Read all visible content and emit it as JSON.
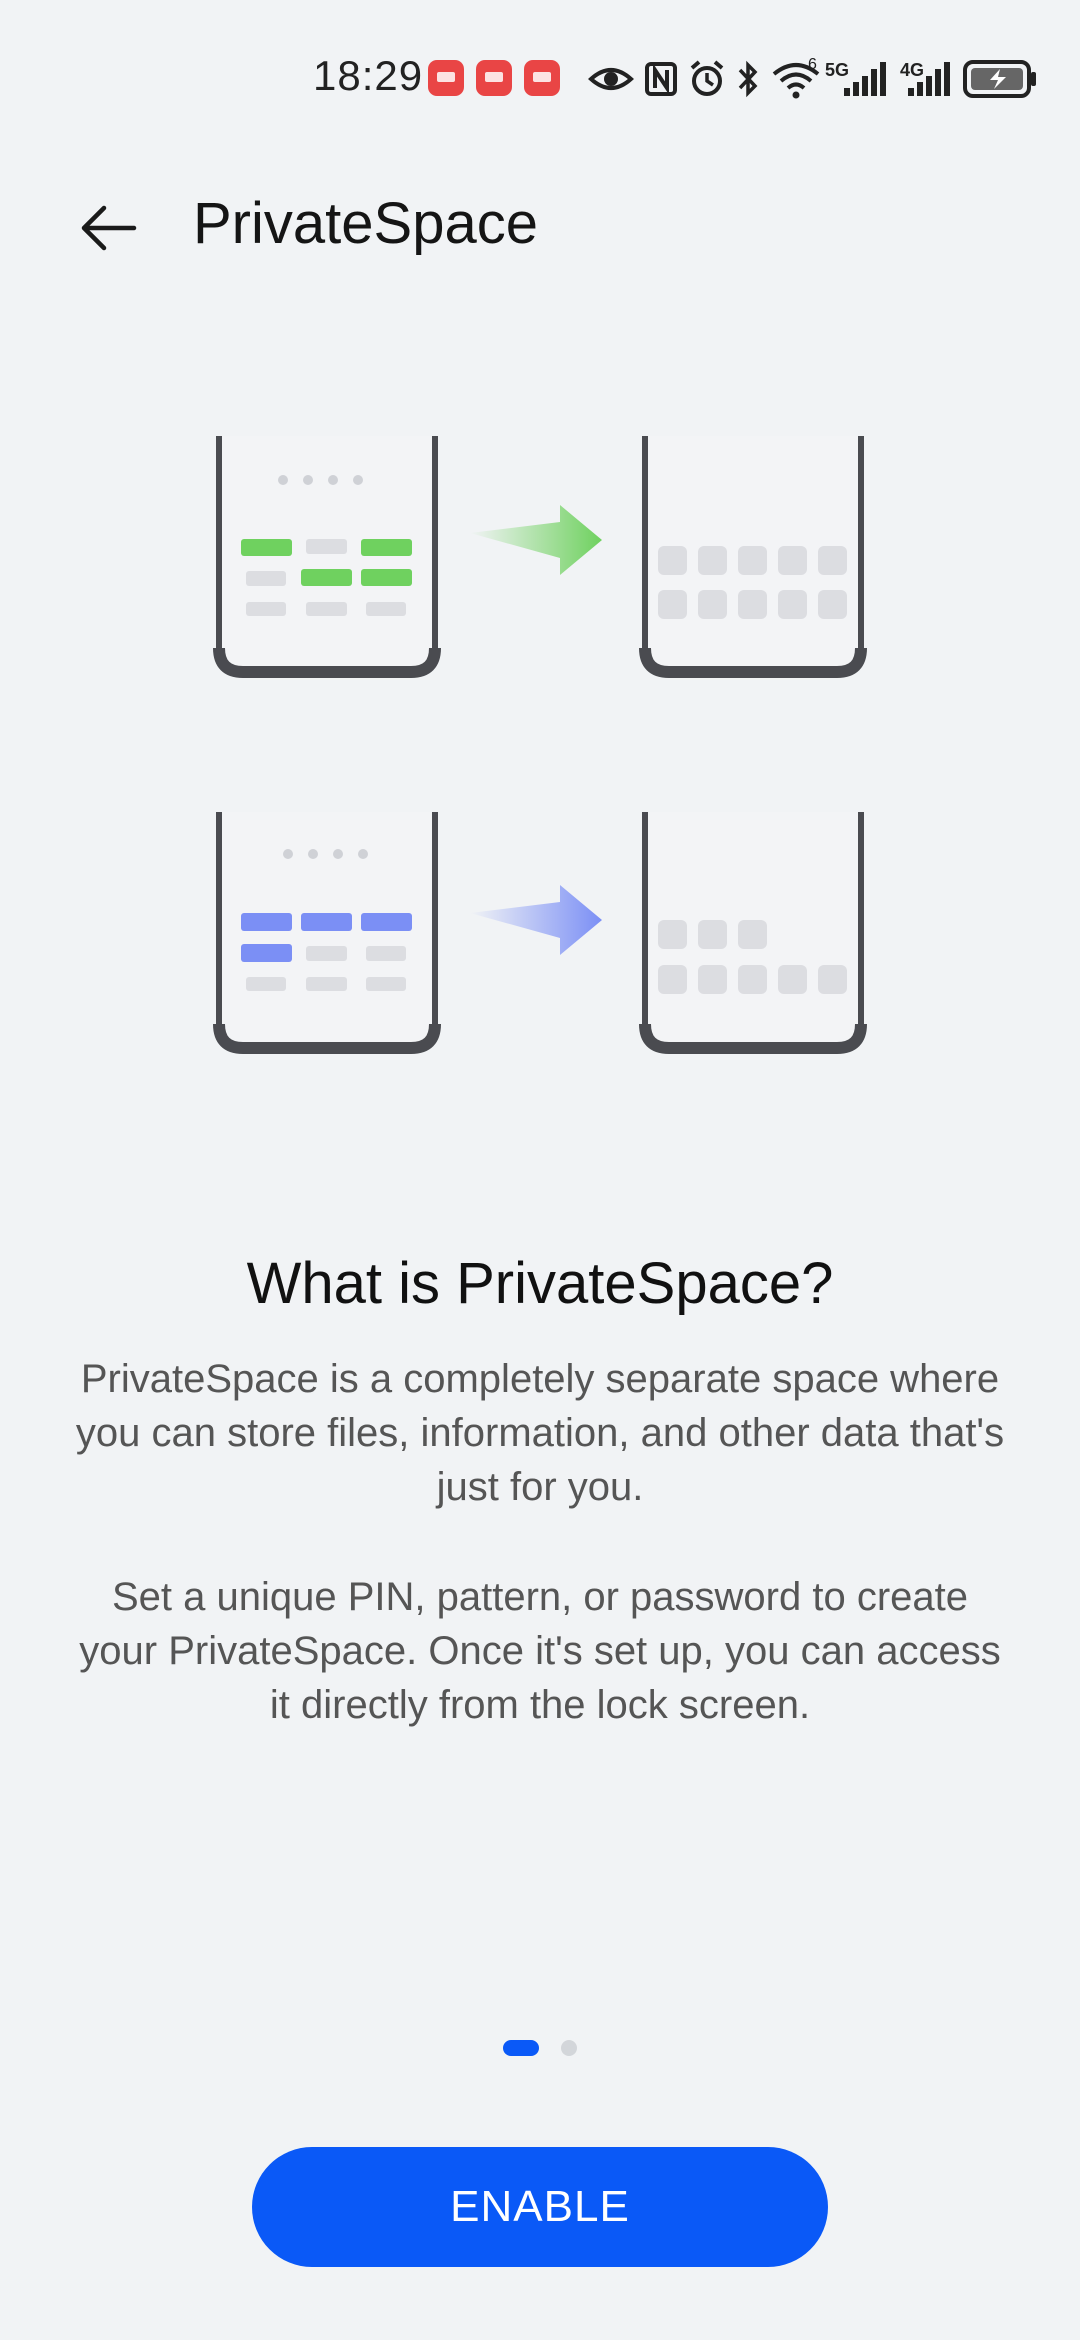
{
  "status_bar": {
    "time": "18:29",
    "network_1": "5G",
    "network_2": "4G",
    "wifi_label": "6",
    "icons": [
      "huawei-appgallery-icon",
      "app-badge-icon",
      "huawei-appgallery-icon",
      "eye-comfort-icon",
      "nfc-icon",
      "alarm-icon",
      "bluetooth-icon",
      "wifi-icon",
      "signal-5g-icon",
      "signal-4g-icon",
      "battery-charging-icon"
    ]
  },
  "header": {
    "title": "PrivateSpace",
    "back_icon": "back-arrow-icon"
  },
  "content": {
    "heading": "What is PrivateSpace?",
    "paragraph_1": "PrivateSpace is a completely separate space where you can store files, information, and other data that's just for you.",
    "paragraph_2": "Set a unique PIN, pattern, or password to create your PrivateSpace. Once it's set up, you can access it directly from the lock screen."
  },
  "pager": {
    "page_count": 2,
    "current_page": 1
  },
  "actions": {
    "enable_label": "ENABLE"
  },
  "colors": {
    "accent": "#0a59f7",
    "green": "#6fd15f",
    "blue": "#7b8ff5",
    "background": "#f1f3f5"
  }
}
